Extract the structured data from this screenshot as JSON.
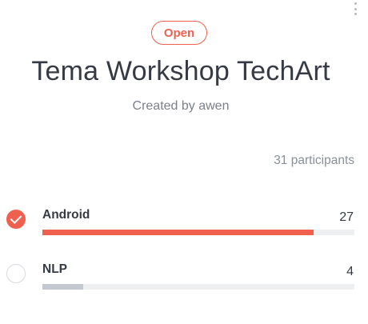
{
  "status": "Open",
  "title": "Tema Workshop TechArt",
  "subtitle": "Created by awen",
  "participants": "31 participants",
  "options": [
    {
      "label": "Android",
      "count": "27",
      "fraction": 0.87,
      "selected": true,
      "bar_color": "#f0604f"
    },
    {
      "label": "NLP",
      "count": "4",
      "fraction": 0.13,
      "selected": false,
      "bar_color": "#c3c7cf"
    }
  ],
  "colors": {
    "accent": "#f0604f",
    "muted_bar": "#c3c7cf",
    "track": "#eeeff1"
  },
  "icons": {
    "menu": "more-vertical-icon",
    "selected": "check-circle-icon",
    "unselected": "empty-radio-icon"
  }
}
